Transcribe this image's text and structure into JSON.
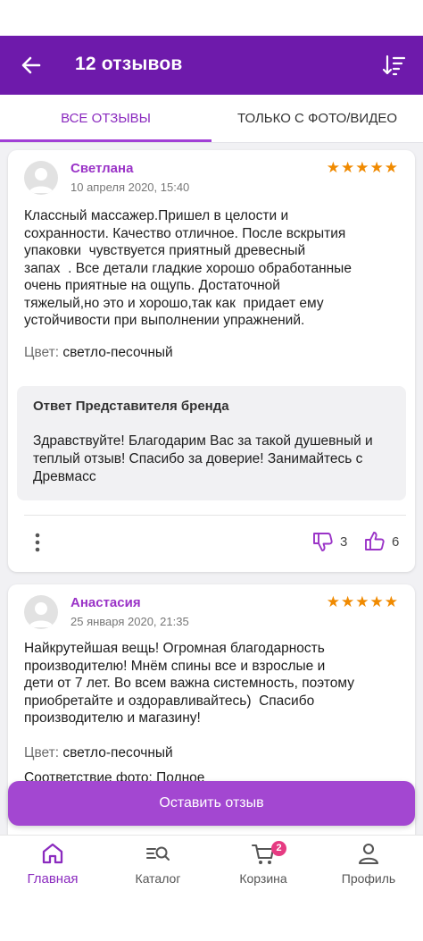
{
  "header": {
    "title": "12 отзывов"
  },
  "tabs": [
    {
      "label": "ВСЕ ОТЗЫВЫ",
      "active": true
    },
    {
      "label": "ТОЛЬКО С ФОТО/ВИДЕО",
      "active": false
    }
  ],
  "reviews": [
    {
      "author": "Светлана",
      "date": "10 апреля 2020, 15:40",
      "stars": "★★★★★",
      "rating": 5,
      "text": "Классный массажер.Пришел в целости и\nсохранности. Качество отличное. После вскрытия\nупаковки  чувствуется приятный древесный\nзапах  . Все детали гладкие хорошо обработанные\nочень приятные на ощупь. Достаточной\nтяжелый,но это и хорошо,так как  придает ему\nустойчивости при выполнении упражнений.",
      "color_label": "Цвет:",
      "color_value": "светло-песочный",
      "reply_title": "Ответ Представителя бренда",
      "reply_text": "Здравствуйте! Благодарим Вас за такой душевный и теплый отзыв! Спасибо за доверие! Занимайтесь с Древмасс",
      "dislikes": "3",
      "likes": "6"
    },
    {
      "author": "Анастасия",
      "date": "25 января 2020, 21:35",
      "stars": "★★★★★",
      "rating": 5,
      "text": "Найкрутейшая вещь! Огромная благодарность\nпроизводителю! Мнём спины все и взрослые и\nдети от 7 лет. Во всем важна системность, поэтому\nприобретайте и оздоравливайтесь)  Спасибо\nпроизводителю и магазину!",
      "color_label": "Цвет:",
      "color_value": "светло-песочный",
      "extra": "Соответствие фото: Полное"
    }
  ],
  "cta": {
    "label": "Оставить отзыв"
  },
  "nav": [
    {
      "label": "Главная",
      "icon": "home-icon",
      "active": true
    },
    {
      "label": "Каталог",
      "icon": "catalog-search-icon",
      "active": false
    },
    {
      "label": "Корзина",
      "icon": "cart-icon",
      "active": false,
      "badge": "2"
    },
    {
      "label": "Профиль",
      "icon": "profile-icon",
      "active": false
    }
  ],
  "colors": {
    "brand": "#6e1aab",
    "accent": "#a347d1",
    "star": "#f08a00",
    "badge": "#e63b82"
  }
}
